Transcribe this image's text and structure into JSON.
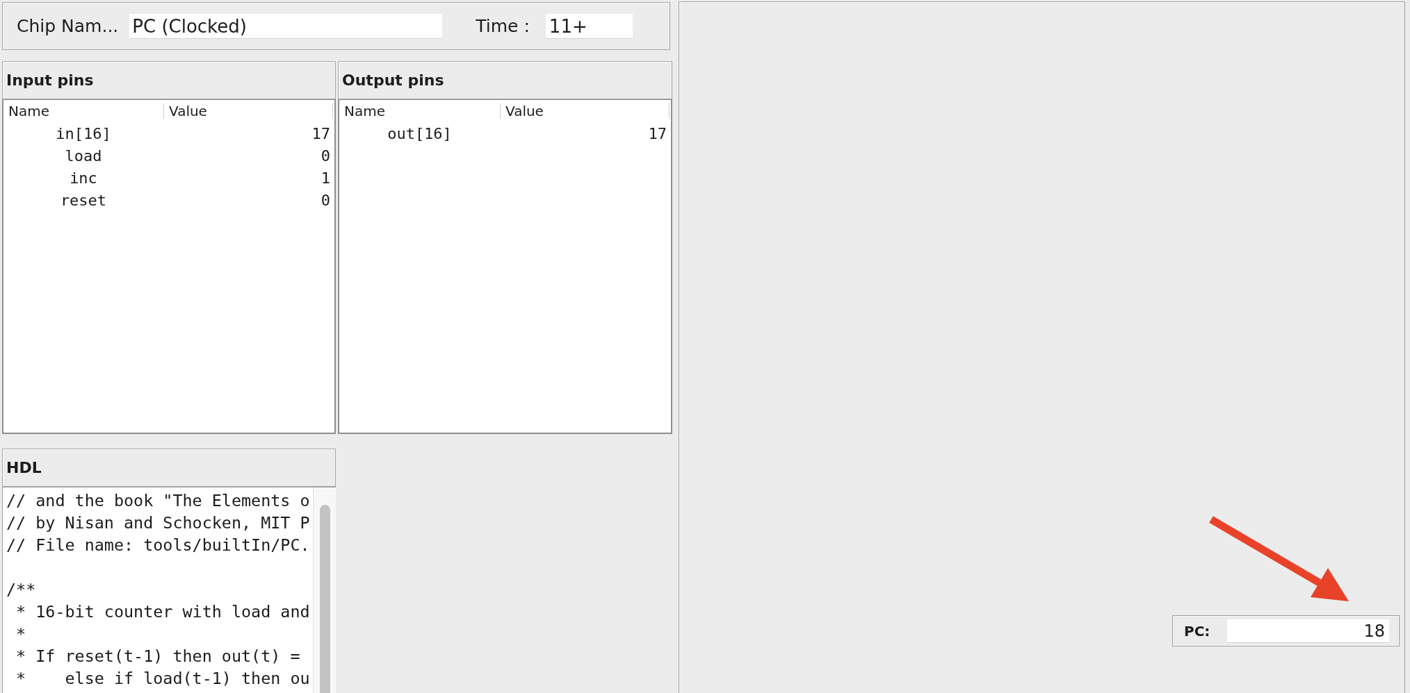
{
  "chip": {
    "label": "Chip Nam...",
    "name": "PC (Clocked)",
    "time_label": "Time :",
    "time": "11+"
  },
  "input_pins": {
    "title": "Input pins",
    "columns": [
      "Name",
      "Value"
    ],
    "rows": [
      {
        "name": "in[16]",
        "value": "17"
      },
      {
        "name": "load",
        "value": "0"
      },
      {
        "name": "inc",
        "value": "1"
      },
      {
        "name": "reset",
        "value": "0"
      }
    ]
  },
  "output_pins": {
    "title": "Output pins",
    "columns": [
      "Name",
      "Value"
    ],
    "rows": [
      {
        "name": "out[16]",
        "value": "17"
      }
    ]
  },
  "hdl": {
    "title": "HDL",
    "blocks": [
      [
        "// and the book \"The Elements o",
        "// by Nisan and Schocken, MIT P",
        "// File name: tools/builtIn/PC."
      ],
      [
        "/**",
        " * 16-bit counter with load and",
        " *",
        " * If reset(t-1) then out(t) =",
        " *    else if load(t-1) then ou"
      ]
    ]
  },
  "pc": {
    "label": "PC:",
    "value": "18"
  }
}
